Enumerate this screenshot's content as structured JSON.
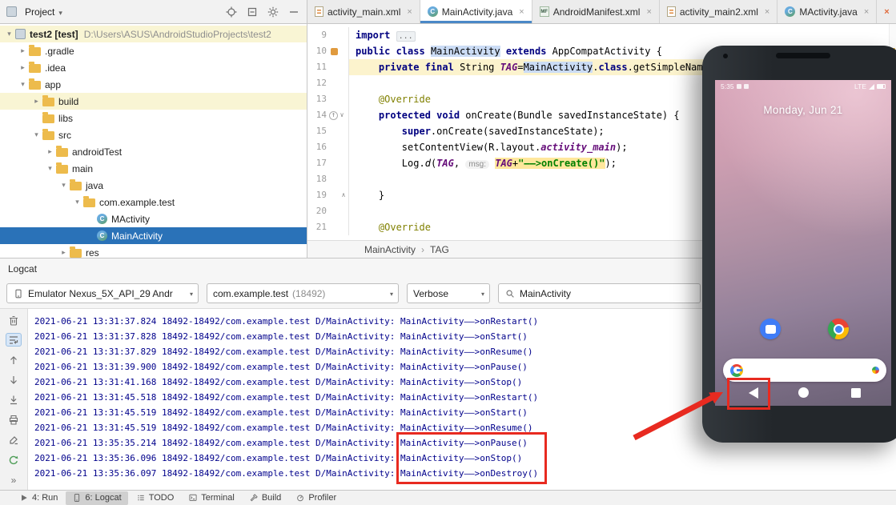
{
  "colors": {
    "annotation_red": "#e82a20",
    "tree_selection_blue": "#2a72b8",
    "tab_accent_blue": "#4a88c7",
    "log_text_blue": "#00008b",
    "folder_yellow": "#edbb4c"
  },
  "ide": {
    "project_header": {
      "title": "Project"
    },
    "tabs": [
      {
        "label": "activity_main.xml",
        "icon": "xml",
        "active": false
      },
      {
        "label": "MainActivity.java",
        "icon": "class",
        "active": true
      },
      {
        "label": "AndroidManifest.xml",
        "icon": "mf",
        "active": false
      },
      {
        "label": "activity_main2.xml",
        "icon": "xml",
        "active": false
      },
      {
        "label": "MActivity.java",
        "icon": "class",
        "active": false
      }
    ],
    "tree": [
      {
        "label": "test2 [test]",
        "path": "D:\\Users\\ASUS\\AndroidStudioProjects\\test2",
        "level": 0,
        "arrow": "open",
        "icon": "project",
        "bold": true,
        "bg": "cream"
      },
      {
        "label": ".gradle",
        "level": 1,
        "arrow": "closed",
        "icon": "folder"
      },
      {
        "label": ".idea",
        "level": 1,
        "arrow": "closed",
        "icon": "folder"
      },
      {
        "label": "app",
        "level": 1,
        "arrow": "open",
        "icon": "folder"
      },
      {
        "label": "build",
        "level": 2,
        "arrow": "closed",
        "icon": "folder",
        "bg": "cream"
      },
      {
        "label": "libs",
        "level": 2,
        "arrow": "none",
        "icon": "folder"
      },
      {
        "label": "src",
        "level": 2,
        "arrow": "open",
        "icon": "folder"
      },
      {
        "label": "androidTest",
        "level": 3,
        "arrow": "closed",
        "icon": "folder"
      },
      {
        "label": "main",
        "level": 3,
        "arrow": "open",
        "icon": "folder"
      },
      {
        "label": "java",
        "level": 4,
        "arrow": "open",
        "icon": "folder"
      },
      {
        "label": "com.example.test",
        "level": 5,
        "arrow": "open",
        "icon": "folder"
      },
      {
        "label": "MActivity",
        "level": 6,
        "arrow": "none",
        "icon": "class"
      },
      {
        "label": "MainActivity",
        "level": 6,
        "arrow": "none",
        "icon": "class",
        "selected": true
      },
      {
        "label": "res",
        "level": 4,
        "arrow": "closed",
        "icon": "folder"
      }
    ],
    "editor": {
      "lines": [
        {
          "n": 9,
          "tok": [
            [
              "import ",
              "k"
            ],
            [
              "...",
              "fold"
            ]
          ]
        },
        {
          "n": 10,
          "g": "class",
          "tok": [
            [
              "public ",
              "k"
            ],
            [
              "class ",
              "k"
            ],
            [
              "MainActivity",
              "p hb"
            ],
            [
              " ",
              "p"
            ],
            [
              "extends ",
              "k"
            ],
            [
              "AppCompatActivity {",
              "p"
            ]
          ]
        },
        {
          "n": 11,
          "bg": "y",
          "tok": [
            [
              "    ",
              "p"
            ],
            [
              "private ",
              "k"
            ],
            [
              "final ",
              "k"
            ],
            [
              "String ",
              "p"
            ],
            [
              "TAG",
              "f"
            ],
            [
              "=",
              "p"
            ],
            [
              "MainActivity",
              "p hb"
            ],
            [
              ".",
              "p"
            ],
            [
              "class",
              "k"
            ],
            [
              ".getSimpleName();",
              "p"
            ]
          ]
        },
        {
          "n": 12,
          "tok": []
        },
        {
          "n": 13,
          "tok": [
            [
              "    ",
              "p"
            ],
            [
              "@Override",
              "a"
            ]
          ]
        },
        {
          "n": 14,
          "g": "override",
          "fold": "v",
          "tok": [
            [
              "    ",
              "p"
            ],
            [
              "protected ",
              "k"
            ],
            [
              "void ",
              "k"
            ],
            [
              "onCreate",
              "p"
            ],
            [
              "(Bundle savedInstanceState) {",
              "p"
            ]
          ]
        },
        {
          "n": 15,
          "tok": [
            [
              "        ",
              "p"
            ],
            [
              "super",
              "k"
            ],
            [
              ".onCreate(savedInstanceState);",
              "p"
            ]
          ]
        },
        {
          "n": 16,
          "tok": [
            [
              "        ",
              "p"
            ],
            [
              "setContentView(R.layout.",
              "p"
            ],
            [
              "activity_main",
              "f"
            ],
            [
              ");",
              "p"
            ]
          ]
        },
        {
          "n": 17,
          "tok": [
            [
              "        ",
              "p"
            ],
            [
              "Log.",
              "p"
            ],
            [
              "d",
              "mi"
            ],
            [
              "(",
              "p"
            ],
            [
              "TAG",
              "f"
            ],
            [
              ", ",
              "p"
            ],
            [
              "msg:",
              "h"
            ],
            [
              " ",
              "p"
            ],
            [
              "TAG",
              "f hy"
            ],
            [
              "+",
              "p hy"
            ],
            [
              "\"——>onCreate()\"",
              "s hy"
            ],
            [
              ");",
              "p"
            ]
          ]
        },
        {
          "n": 18,
          "tok": []
        },
        {
          "n": 19,
          "fold": "^",
          "tok": [
            [
              "    ",
              "p"
            ],
            [
              "}",
              "p"
            ]
          ]
        },
        {
          "n": 20,
          "tok": []
        },
        {
          "n": 21,
          "tok": [
            [
              "    ",
              "p"
            ],
            [
              "@Override",
              "a"
            ]
          ]
        }
      ]
    },
    "breadcrumb": [
      "MainActivity",
      "TAG"
    ],
    "logcat": {
      "title": "Logcat",
      "filters": {
        "device": "Emulator Nexus_5X_API_29 Andr",
        "app": "com.example.test",
        "app_pid": "(18492)",
        "level": "Verbose",
        "search": "MainActivity"
      },
      "lines": [
        {
          "prefix": "2021-06-21 13:31:37.824 18492-18492/com.example.test D/MainActivity: ",
          "message": "MainActivity——>onRestart()"
        },
        {
          "prefix": "2021-06-21 13:31:37.828 18492-18492/com.example.test D/MainActivity: ",
          "message": "MainActivity——>onStart()"
        },
        {
          "prefix": "2021-06-21 13:31:37.829 18492-18492/com.example.test D/MainActivity: ",
          "message": "MainActivity——>onResume()"
        },
        {
          "prefix": "2021-06-21 13:31:39.900 18492-18492/com.example.test D/MainActivity: ",
          "message": "MainActivity——>onPause()"
        },
        {
          "prefix": "2021-06-21 13:31:41.168 18492-18492/com.example.test D/MainActivity: ",
          "message": "MainActivity——>onStop()"
        },
        {
          "prefix": "2021-06-21 13:31:45.518 18492-18492/com.example.test D/MainActivity: ",
          "message": "MainActivity——>onRestart()"
        },
        {
          "prefix": "2021-06-21 13:31:45.519 18492-18492/com.example.test D/MainActivity: ",
          "message": "MainActivity——>onStart()"
        },
        {
          "prefix": "2021-06-21 13:31:45.519 18492-18492/com.example.test D/MainActivity: ",
          "message": "MainActivity——>onResume()"
        },
        {
          "prefix": "2021-06-21 13:35:35.214 18492-18492/com.example.test D/MainActivity: ",
          "message": "MainActivity——>onPause()"
        },
        {
          "prefix": "2021-06-21 13:35:36.096 18492-18492/com.example.test D/MainActivity: ",
          "message": "MainActivity——>onStop()"
        },
        {
          "prefix": "2021-06-21 13:35:36.097 18492-18492/com.example.test D/MainActivity: ",
          "message": "MainActivity——>onDestroy()"
        }
      ]
    },
    "statusbar": [
      {
        "label": "4: Run",
        "icon": "run",
        "active": false
      },
      {
        "label": "6: Logcat",
        "icon": "logcat",
        "active": true
      },
      {
        "label": "TODO",
        "icon": "todo",
        "active": false
      },
      {
        "label": "Terminal",
        "icon": "terminal",
        "active": false
      },
      {
        "label": "Build",
        "icon": "build",
        "active": false
      },
      {
        "label": "Profiler",
        "icon": "profiler",
        "active": false
      }
    ]
  },
  "emulator": {
    "status": {
      "time": "5:35",
      "network": "LTE"
    },
    "date": "Monday, Jun 21"
  }
}
